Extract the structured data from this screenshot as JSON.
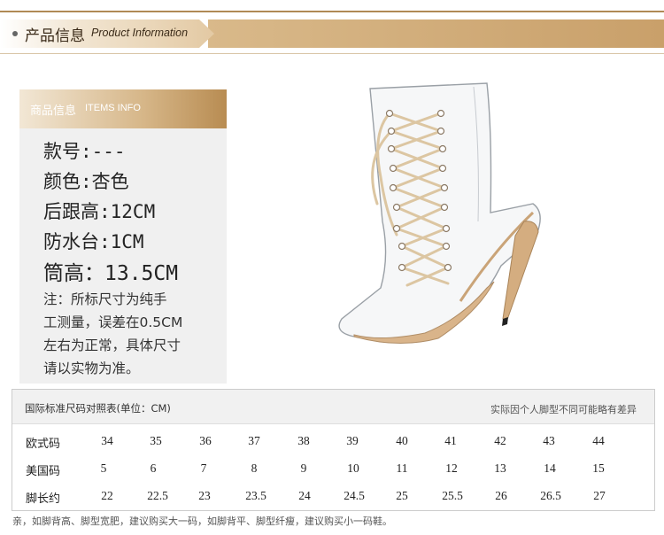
{
  "header": {
    "title_cn": "产品信息",
    "title_en": "Product Information"
  },
  "info": {
    "head_cn": "商品信息",
    "head_en": "ITEMS INFO",
    "specs": [
      "款号:---",
      "颜色:杏色",
      "后跟高:12CM",
      "防水台:1CM",
      "筒高：13.5CM"
    ],
    "note_lines": [
      "注：所标尺寸为纯手",
      "工测量，误差在0.5CM",
      "左右为正常，具体尺寸",
      "请以实物为准。"
    ]
  },
  "size_table": {
    "title": "国际标准尺码对照表(单位：CM)",
    "right_note": "实际因个人脚型不同可能略有差异",
    "rows": [
      {
        "label": "欧式码",
        "values": [
          "34",
          "35",
          "36",
          "37",
          "38",
          "39",
          "40",
          "41",
          "42",
          "43",
          "44"
        ]
      },
      {
        "label": "美国码",
        "values": [
          "5",
          "6",
          "7",
          "8",
          "9",
          "10",
          "11",
          "12",
          "13",
          "14",
          "15"
        ]
      },
      {
        "label": "脚长约",
        "values": [
          "22",
          "22.5",
          "23",
          "23.5",
          "24",
          "24.5",
          "25",
          "25.5",
          "26",
          "26.5",
          "27"
        ]
      }
    ]
  },
  "footnote": "亲，如脚背高、脚型宽肥，建议购买大一码，如脚背平、脚型纤瘦，建议购买小一码鞋。",
  "colors": {
    "accent": "#c9a06a",
    "panel_bg": "#f0f0f0"
  }
}
